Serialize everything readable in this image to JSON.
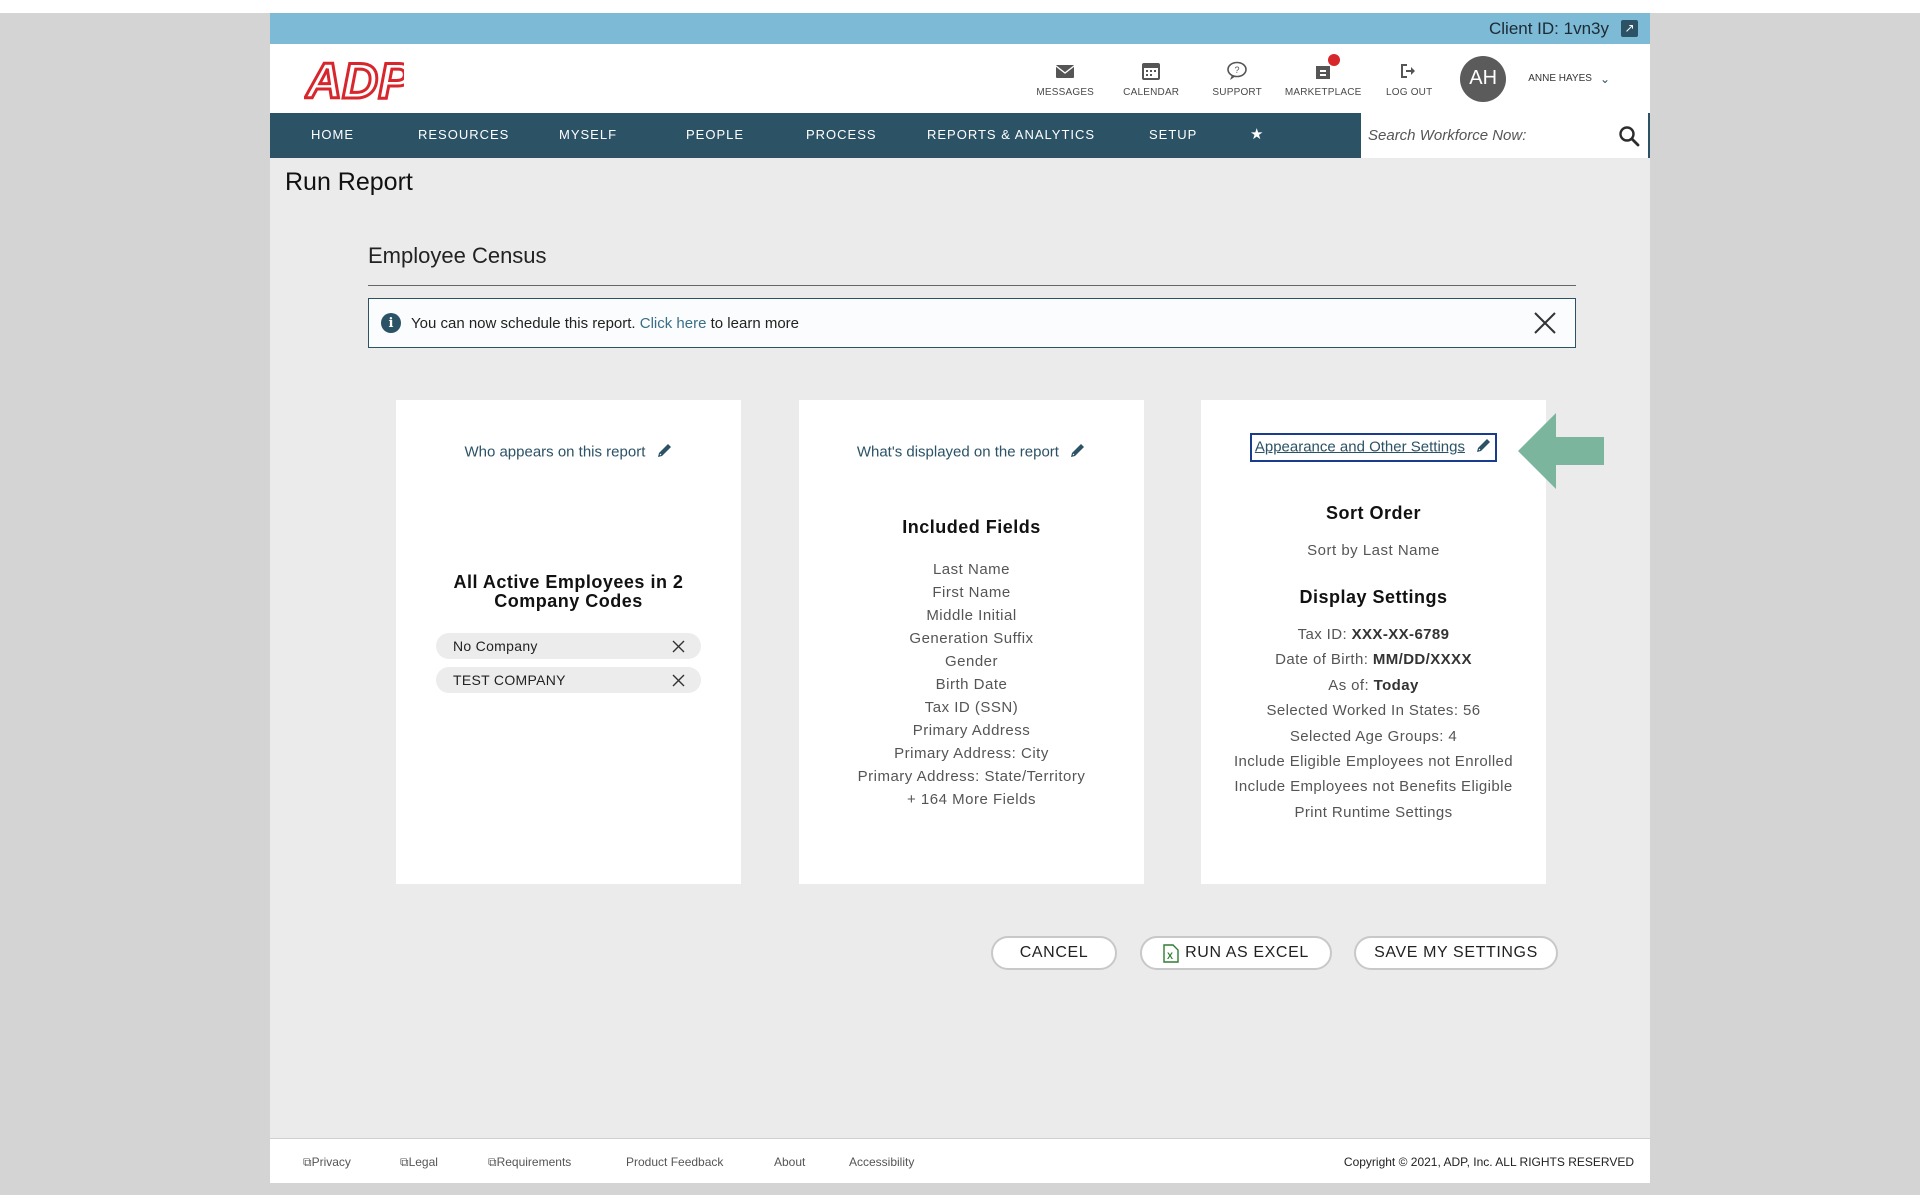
{
  "client": {
    "label": "Client ID: 1vn3y"
  },
  "header": {
    "logo_text": "ADP",
    "utils": [
      {
        "label": "MESSAGES",
        "icon": "envelope-icon"
      },
      {
        "label": "CALENDAR",
        "icon": "calendar-icon"
      },
      {
        "label": "SUPPORT",
        "icon": "chat-bubble-icon"
      },
      {
        "label": "MARKETPLACE",
        "icon": "store-icon",
        "has_notification": true
      },
      {
        "label": "LOG OUT",
        "icon": "logout-icon"
      }
    ],
    "avatar_initials": "AH",
    "user_name": "ANNE HAYES"
  },
  "nav": {
    "items": [
      "HOME",
      "RESOURCES",
      "MYSELF",
      "PEOPLE",
      "PROCESS",
      "REPORTS & ANALYTICS",
      "SETUP"
    ],
    "favorite_icon": "star-icon",
    "search_placeholder": "Search Workforce Now:"
  },
  "page": {
    "title": "Run Report",
    "report_name": "Employee Census"
  },
  "notice": {
    "text_before": "You can now schedule this report.",
    "link": "Click here",
    "text_after": "to learn more"
  },
  "cards": {
    "who": {
      "link": "Who appears on this report",
      "heading": "All Active Employees in 2 Company Codes",
      "companies": [
        "No Company",
        "TEST COMPANY"
      ]
    },
    "what": {
      "link": "What's displayed on the report",
      "heading": "Included Fields",
      "fields": [
        "Last Name",
        "First Name",
        "Middle Initial",
        "Generation Suffix",
        "Gender",
        "Birth Date",
        "Tax ID (SSN)",
        "Primary Address",
        "Primary Address: City",
        "Primary Address: State/Territory",
        "+ 164 More Fields"
      ]
    },
    "settings": {
      "link": "Appearance and Other Settings",
      "sort_heading": "Sort Order",
      "sort_value": "Sort by Last Name",
      "display_heading": "Display Settings",
      "taxid_label": "Tax ID:",
      "taxid_value": "XXX-XX-6789",
      "dob_label": "Date of Birth:",
      "dob_value": "MM/DD/XXXX",
      "asof_label": "As of:",
      "asof_value": "Today",
      "lines": [
        "Selected Worked In States: 56",
        "Selected Age Groups: 4",
        "Include Eligible Employees not Enrolled",
        "Include Employees not Benefits Eligible",
        "Print Runtime Settings"
      ]
    }
  },
  "buttons": {
    "cancel": "CANCEL",
    "run_excel": "RUN AS EXCEL",
    "save": "SAVE MY SETTINGS"
  },
  "footer": {
    "links": [
      "Privacy",
      "Legal",
      "Requirements",
      "Product Feedback",
      "About",
      "Accessibility"
    ],
    "copyright": "Copyright © 2021, ADP, Inc. ALL RIGHTS RESERVED"
  },
  "colors": {
    "nav": "#2c5266",
    "client_bar": "#7cbad6",
    "brand_red": "#d7262c",
    "pointer_arrow": "#7cb59e"
  }
}
